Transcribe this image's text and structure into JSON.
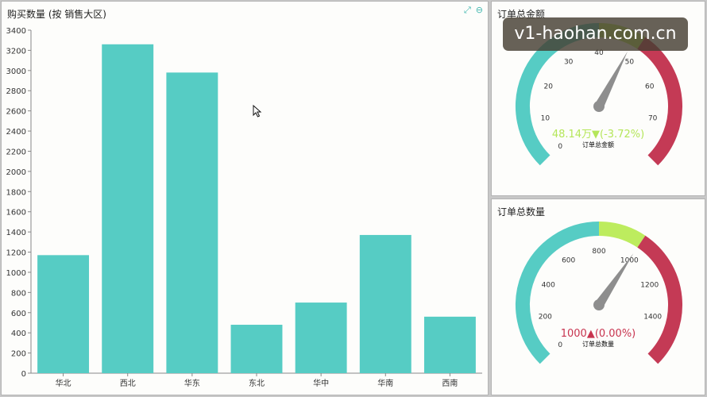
{
  "bar_panel": {
    "title": "购买数量 (按 销售大区)",
    "tools": {
      "expand_icon": "⤢",
      "minus_icon": "⊖"
    }
  },
  "gauge_amount": {
    "title": "订单总金额",
    "value_text": "48.14万▼(-3.72%)",
    "label": "订单总金额",
    "value_color": "#b5e65a"
  },
  "gauge_count": {
    "title": "订单总数量",
    "value_text": "1000▲(0.00%)",
    "label": "订单总数量",
    "value_color": "#c8344f"
  },
  "watermark": "v1-haohan.com.cn",
  "colors": {
    "bar": "#56ccc4",
    "teal": "#56ccc4",
    "lime": "#bdec5e",
    "red": "#c43a55",
    "needle": "#8e8e8e"
  },
  "chart_data": [
    {
      "type": "bar",
      "title": "购买数量 (按 销售大区)",
      "categories": [
        "华北",
        "西北",
        "华东",
        "东北",
        "华中",
        "华南",
        "西南"
      ],
      "values": [
        1170,
        3260,
        2980,
        480,
        700,
        1370,
        560
      ],
      "ylim": [
        0,
        3400
      ],
      "yticks": [
        0,
        200,
        400,
        600,
        800,
        1000,
        1200,
        1400,
        1600,
        1800,
        2000,
        2200,
        2400,
        2600,
        2800,
        3000,
        3200,
        3400
      ],
      "grid": false
    },
    {
      "type": "gauge",
      "title": "订单总金额",
      "min": 0,
      "max": 80,
      "value": 48.14,
      "ticks": [
        0,
        10,
        20,
        30,
        40,
        50,
        60,
        70
      ],
      "bands": [
        {
          "from": 0,
          "to": 40,
          "color": "#56ccc4"
        },
        {
          "from": 40,
          "to": 50,
          "color": "#bdec5e"
        },
        {
          "from": 50,
          "to": 80,
          "color": "#c43a55"
        }
      ]
    },
    {
      "type": "gauge",
      "title": "订单总数量",
      "min": 0,
      "max": 1600,
      "value": 1000,
      "ticks": [
        0,
        200,
        400,
        600,
        800,
        1000,
        1200,
        1400
      ],
      "bands": [
        {
          "from": 0,
          "to": 800,
          "color": "#56ccc4"
        },
        {
          "from": 800,
          "to": 1000,
          "color": "#bdec5e"
        },
        {
          "from": 1000,
          "to": 1600,
          "color": "#c43a55"
        }
      ]
    }
  ]
}
